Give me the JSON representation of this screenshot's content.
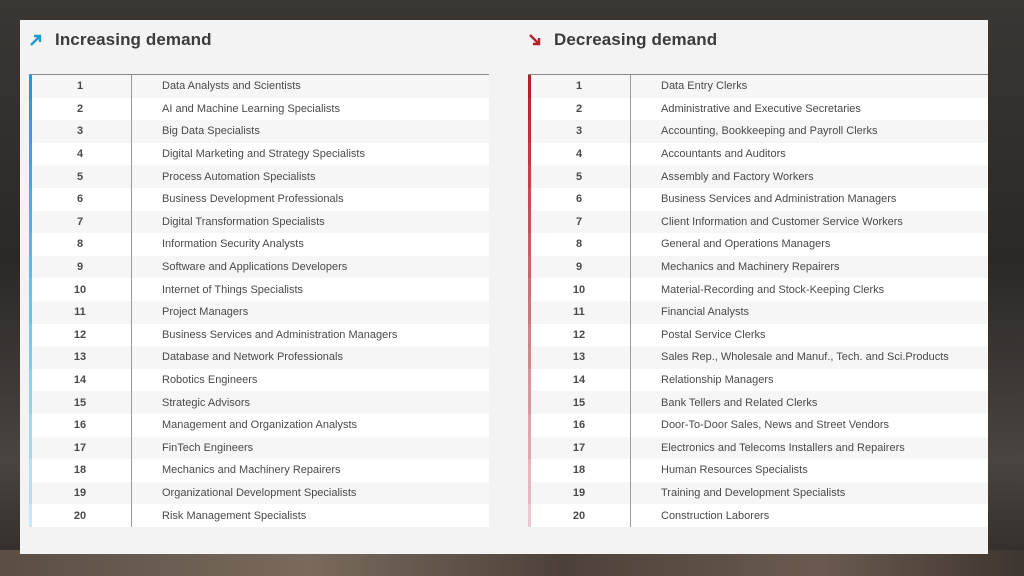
{
  "colors": {
    "increasing_accent": "#1e9ad6",
    "decreasing_accent": "#b3202a"
  },
  "increasing": {
    "title": "Increasing demand",
    "icon": "arrow-up-right-icon",
    "rows": [
      {
        "rank": "1",
        "role": "Data Analysts and Scientists"
      },
      {
        "rank": "2",
        "role": "AI and Machine Learning Specialists"
      },
      {
        "rank": "3",
        "role": "Big Data Specialists"
      },
      {
        "rank": "4",
        "role": "Digital Marketing and Strategy Specialists"
      },
      {
        "rank": "5",
        "role": "Process Automation Specialists"
      },
      {
        "rank": "6",
        "role": "Business Development Professionals"
      },
      {
        "rank": "7",
        "role": "Digital Transformation Specialists"
      },
      {
        "rank": "8",
        "role": "Information Security Analysts"
      },
      {
        "rank": "9",
        "role": "Software and Applications Developers"
      },
      {
        "rank": "10",
        "role": "Internet of Things Specialists"
      },
      {
        "rank": "11",
        "role": "Project Managers"
      },
      {
        "rank": "12",
        "role": "Business Services and Administration Managers"
      },
      {
        "rank": "13",
        "role": "Database and Network Professionals"
      },
      {
        "rank": "14",
        "role": "Robotics Engineers"
      },
      {
        "rank": "15",
        "role": "Strategic Advisors"
      },
      {
        "rank": "16",
        "role": "Management and Organization Analysts"
      },
      {
        "rank": "17",
        "role": "FinTech Engineers"
      },
      {
        "rank": "18",
        "role": "Mechanics and Machinery Repairers"
      },
      {
        "rank": "19",
        "role": "Organizational Development Specialists"
      },
      {
        "rank": "20",
        "role": "Risk Management Specialists"
      }
    ]
  },
  "decreasing": {
    "title": "Decreasing demand",
    "icon": "arrow-down-right-icon",
    "rows": [
      {
        "rank": "1",
        "role": "Data Entry Clerks"
      },
      {
        "rank": "2",
        "role": "Administrative and Executive Secretaries"
      },
      {
        "rank": "3",
        "role": "Accounting,  Bookkeeping and Payroll Clerks"
      },
      {
        "rank": "4",
        "role": "Accountants and Auditors"
      },
      {
        "rank": "5",
        "role": "Assembly and Factory Workers"
      },
      {
        "rank": "6",
        "role": "Business Services and Administration Managers"
      },
      {
        "rank": "7",
        "role": "Client Information and Customer Service Workers"
      },
      {
        "rank": "8",
        "role": "General and Operations Managers"
      },
      {
        "rank": "9",
        "role": "Mechanics and Machinery Repairers"
      },
      {
        "rank": "10",
        "role": "Material-Recording and Stock-Keeping Clerks"
      },
      {
        "rank": "11",
        "role": "Financial Analysts"
      },
      {
        "rank": "12",
        "role": "Postal Service Clerks"
      },
      {
        "rank": "13",
        "role": "Sales Rep., Wholesale and Manuf., Tech. and Sci.Products"
      },
      {
        "rank": "14",
        "role": "Relationship Managers"
      },
      {
        "rank": "15",
        "role": "Bank Tellers and Related Clerks"
      },
      {
        "rank": "16",
        "role": "Door-To-Door Sales, News and Street Vendors"
      },
      {
        "rank": "17",
        "role": "Electronics and Telecoms Installers and Repairers"
      },
      {
        "rank": "18",
        "role": "Human Resources Specialists"
      },
      {
        "rank": "19",
        "role": "Training and Development Specialists"
      },
      {
        "rank": "20",
        "role": "Construction Laborers"
      }
    ]
  }
}
